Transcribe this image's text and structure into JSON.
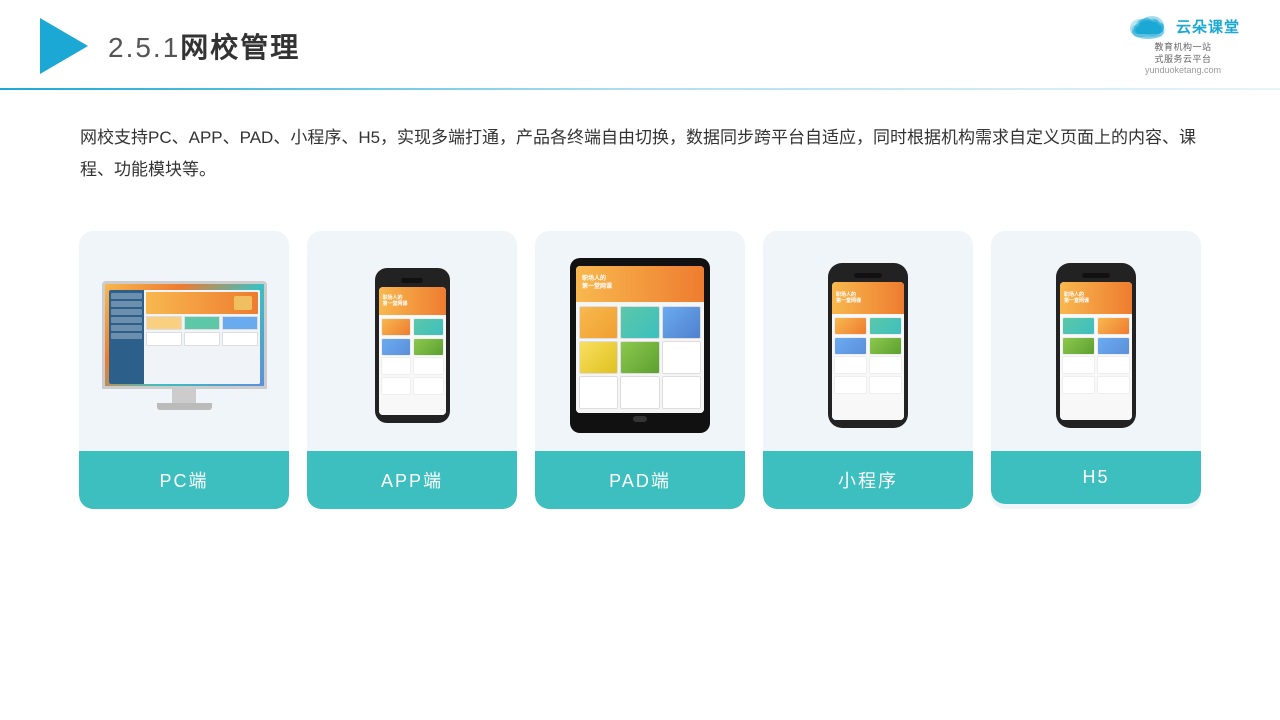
{
  "header": {
    "section_number": "2.5.1",
    "section_title": "网校管理",
    "brand_name": "云朵课堂",
    "brand_domain": "yunduoketang.com",
    "brand_tagline": "教育机构一站\n式服务云平台"
  },
  "description": {
    "text": "网校支持PC、APP、PAD、小程序、H5，实现多端打通，产品各终端自由切换，数据同步跨平台自适应，同时根据机构需求自定义页面上的内容、课程、功能模块等。"
  },
  "cards": [
    {
      "id": "pc",
      "label": "PC端"
    },
    {
      "id": "app",
      "label": "APP端"
    },
    {
      "id": "pad",
      "label": "PAD端"
    },
    {
      "id": "mini",
      "label": "小程序"
    },
    {
      "id": "h5",
      "label": "H5"
    }
  ]
}
